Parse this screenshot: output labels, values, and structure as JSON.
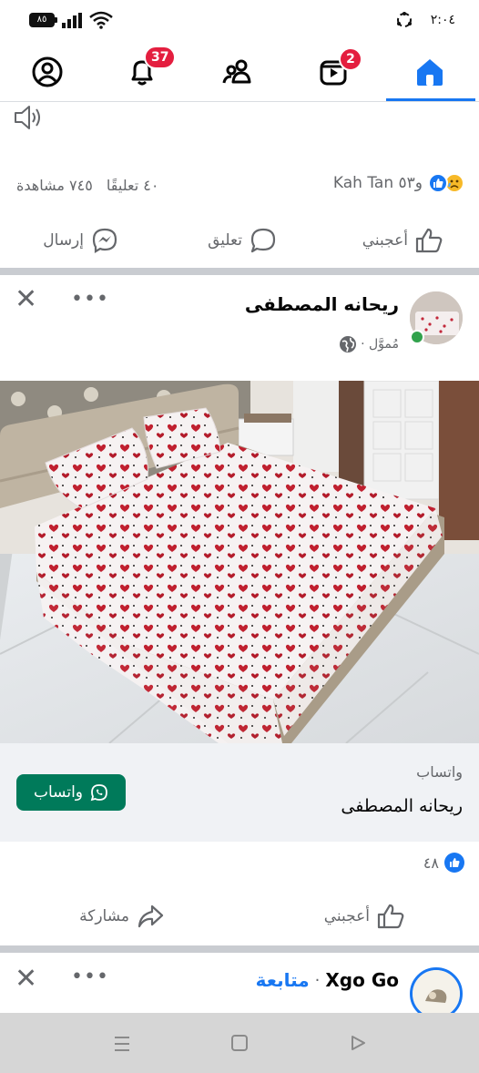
{
  "status_bar": {
    "time": "٢:٠٤",
    "battery": "٨٥"
  },
  "top_nav": {
    "items": [
      {
        "name": "profile-icon"
      },
      {
        "name": "notifications-icon",
        "badge": "37"
      },
      {
        "name": "friends-icon"
      },
      {
        "name": "video-icon",
        "badge": "2"
      },
      {
        "name": "home-icon",
        "active": true
      }
    ]
  },
  "post1": {
    "reactions_text": "Kah Tan و٥٣",
    "comments_text": "٤٠ تعليقًا",
    "views_text": "٧٤٥ مشاهدة",
    "actions": {
      "like": "أعجبني",
      "comment": "تعليق",
      "send": "إرسال"
    }
  },
  "post2": {
    "author": "ريحانه المصطفى",
    "sponsored": "مُموَّل ·",
    "cta_label": "واتساب",
    "cta_name": "ريحانه المصطفى",
    "cta_button": "واتساب",
    "likes_count": "٤٨",
    "actions": {
      "like": "أعجبني",
      "share": "مشاركة"
    }
  },
  "post3": {
    "author": "Xgo Go",
    "follow": "متابعة",
    "separator": "·"
  },
  "colors": {
    "accent": "#1877f2",
    "badge": "#e41e3f",
    "whatsapp": "#007a5a"
  }
}
